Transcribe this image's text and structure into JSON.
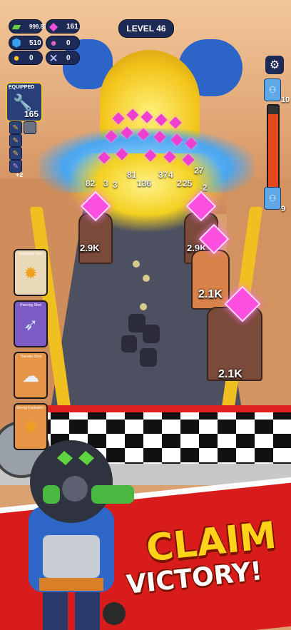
{
  "hud": {
    "cash": "999.87M",
    "gems": "161",
    "blue_crystals": "510",
    "special": "0",
    "coins": "0",
    "keys": "0",
    "level": "LEVEL 46",
    "progress_top": "10",
    "progress_bottom": "9",
    "progress_fraction": 0.9
  },
  "equipped": {
    "title": "EQUIPPED",
    "value": "165",
    "extra_count": "+2"
  },
  "cards": [
    {
      "label": "Explosion Shot",
      "color": "#e9d9b9",
      "icon": "explosion-icon"
    },
    {
      "label": "Piercing Shot",
      "color": "#7c5bc4",
      "icon": "piercing-icon"
    },
    {
      "label": "Thunder Shot",
      "color": "#e69447",
      "icon": "thunder-icon"
    },
    {
      "label": "Strong Explosion Shot",
      "color": "#e69447",
      "icon": "strong-explosion-icon"
    }
  ],
  "crowd_numbers": [
    "82",
    "3",
    "3",
    "81",
    "136",
    "37",
    "4",
    "2",
    "25",
    "27",
    "2"
  ],
  "pillars": [
    {
      "label": "2.9K"
    },
    {
      "label": "2.9K"
    },
    {
      "label": "2.1K"
    },
    {
      "label": "2.1K"
    }
  ],
  "promo": {
    "line1": "CLAIM",
    "line2": "VICTORY!"
  },
  "colors": {
    "hud_bg": "#1c2a55",
    "banner_red": "#d81c1c",
    "claim_yellow": "#ffd21a",
    "gem_pink": "#ff4fe0"
  }
}
